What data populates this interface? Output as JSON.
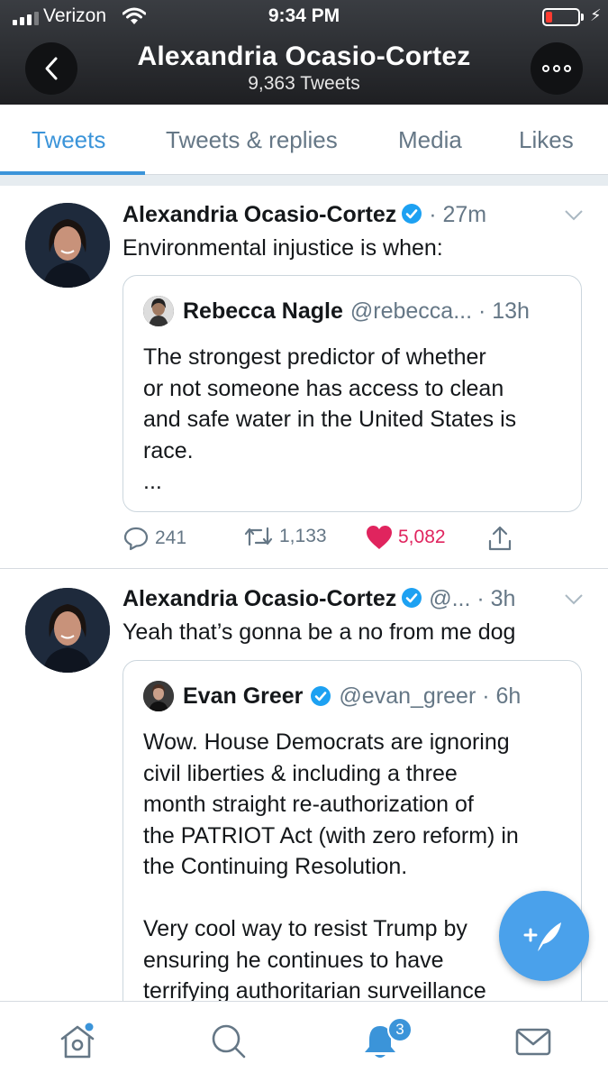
{
  "status_bar": {
    "carrier": "Verizon",
    "time": "9:34 PM",
    "battery_level": 0.2
  },
  "header": {
    "name": "Alexandria Ocasio-Cortez",
    "tweet_count": "9,363 Tweets"
  },
  "tabs": [
    {
      "label": "Tweets",
      "active": true
    },
    {
      "label": "Tweets & replies",
      "active": false
    },
    {
      "label": "Media",
      "active": false
    },
    {
      "label": "Likes",
      "active": false
    }
  ],
  "tweets": [
    {
      "author": "Alexandria Ocasio-Cortez",
      "meta": "· 27m",
      "text": "Environmental injustice is when:",
      "quote": {
        "author": "Rebecca Nagle",
        "meta": "@rebecca... · 13h",
        "lines": [
          "The strongest predictor of whether",
          "or not someone has access to clean",
          "and safe water in the United States is",
          "race.",
          "..."
        ]
      },
      "actions": {
        "replies": "241",
        "retweets": "1,133",
        "likes": "5,082"
      }
    },
    {
      "author": "Alexandria Ocasio-Cortez",
      "meta": "@... · 3h",
      "text": "Yeah that’s gonna be a no from me dog",
      "quote": {
        "author": "Evan Greer",
        "meta": "@evan_greer · 6h",
        "lines": [
          "Wow. House Democrats are ignoring",
          "civil liberties & including a three",
          "month straight re-authorization of",
          "the PATRIOT Act (with zero reform) in",
          "the Continuing Resolution.",
          "",
          "Very cool way to resist Trump by",
          "ensuring he continues to have",
          "terrifying authoritarian surveillance"
        ]
      }
    }
  ],
  "bottom_nav": {
    "notifications_badge": "3"
  },
  "colors": {
    "accent": "#3b94d9",
    "like": "#e0245e",
    "muted": "#657786",
    "verified": "#1da1f2"
  },
  "icons": [
    "back-arrow-icon",
    "more-icon",
    "verified-badge-icon",
    "chevron-down-icon",
    "reply-icon",
    "retweet-icon",
    "heart-icon",
    "share-icon",
    "compose-icon",
    "home-icon",
    "search-icon",
    "bell-icon",
    "mail-icon"
  ]
}
